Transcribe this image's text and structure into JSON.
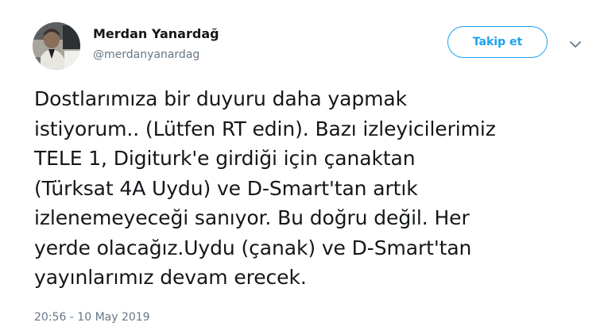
{
  "author": {
    "display_name": "Merdan Yanardağ",
    "handle": "@merdanyanardag"
  },
  "actions": {
    "follow_label": "Takip et",
    "menu_icon": "chevron-down-icon"
  },
  "tweet": {
    "lines": [
      "Dostlarımıza bir duyuru daha yapmak",
      "istiyorum.. (Lütfen RT edin). Bazı izleyicilerimiz",
      "TELE 1, Digiturk'e girdiği için çanaktan",
      "(Türksat 4A Uydu) ve D-Smart'tan artık",
      "izlenemeyeceği sanıyor. Bu doğru değil. Her",
      "yerde olacağız.Uydu (çanak) ve D-Smart'tan",
      "yayınlarımız devam erecek."
    ],
    "timestamp": "20:56 - 10 May 2019"
  },
  "colors": {
    "accent": "#1da1f2",
    "text": "#14171a",
    "secondary_text": "#657786"
  }
}
